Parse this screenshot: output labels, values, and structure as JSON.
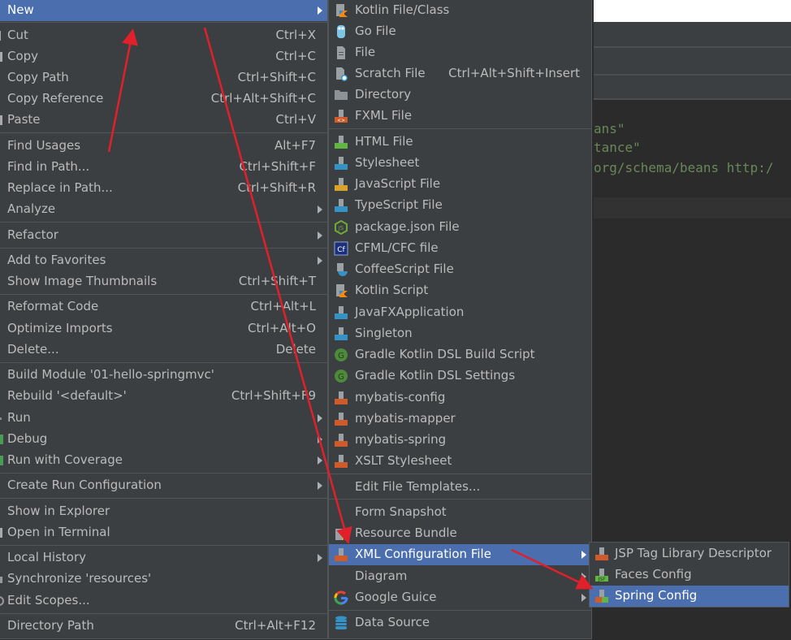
{
  "editor": {
    "code_lines": [
      "ans\"",
      "tance\"",
      "org/schema/beans http:/"
    ]
  },
  "context_menu": {
    "items": [
      {
        "label": "New",
        "shortcut": "",
        "submenu": true,
        "selected": true
      },
      {
        "label": "Cut",
        "shortcut": "Ctrl+X",
        "icon": "cut-icon"
      },
      {
        "label": "Copy",
        "shortcut": "Ctrl+C",
        "icon": "copy-icon"
      },
      {
        "label": "Copy Path",
        "shortcut": "Ctrl+Shift+C"
      },
      {
        "label": "Copy Reference",
        "shortcut": "Ctrl+Alt+Shift+C"
      },
      {
        "label": "Paste",
        "shortcut": "Ctrl+V",
        "icon": "paste-icon"
      },
      {
        "label": "Find Usages",
        "shortcut": "Alt+F7"
      },
      {
        "label": "Find in Path...",
        "shortcut": "Ctrl+Shift+F"
      },
      {
        "label": "Replace in Path...",
        "shortcut": "Ctrl+Shift+R"
      },
      {
        "label": "Analyze",
        "submenu": true
      },
      {
        "label": "Refactor",
        "submenu": true
      },
      {
        "label": "Add to Favorites",
        "submenu": true
      },
      {
        "label": "Show Image Thumbnails",
        "shortcut": "Ctrl+Shift+T"
      },
      {
        "label": "Reformat Code",
        "shortcut": "Ctrl+Alt+L"
      },
      {
        "label": "Optimize Imports",
        "shortcut": "Ctrl+Alt+O"
      },
      {
        "label": "Delete...",
        "shortcut": "Delete"
      },
      {
        "label": "Build Module '01-hello-springmvc'",
        "shortcut": ""
      },
      {
        "label": "Rebuild '<default>'",
        "shortcut": "Ctrl+Shift+F9"
      },
      {
        "label": "Run",
        "submenu": true,
        "icon": "run-icon"
      },
      {
        "label": "Debug",
        "submenu": true,
        "icon": "debug-icon"
      },
      {
        "label": "Run with Coverage",
        "submenu": true,
        "icon": "coverage-icon"
      },
      {
        "label": "Create Run Configuration",
        "submenu": true
      },
      {
        "label": "Show in Explorer"
      },
      {
        "label": "Open in Terminal",
        "icon": "terminal-icon"
      },
      {
        "label": "Local History",
        "submenu": true
      },
      {
        "label": "Synchronize 'resources'",
        "icon": "sync-icon"
      },
      {
        "label": "Edit Scopes...",
        "icon": "scopes-icon"
      },
      {
        "label": "Directory Path",
        "shortcut": "Ctrl+Alt+F12"
      }
    ]
  },
  "new_submenu": {
    "items": [
      {
        "label": "Kotlin File/Class",
        "icon": "kotlin-file-icon"
      },
      {
        "label": "Go File",
        "icon": "go-gopher-icon"
      },
      {
        "label": "File",
        "icon": "file-icon"
      },
      {
        "label": "Scratch File",
        "shortcut": "Ctrl+Alt+Shift+Insert",
        "icon": "scratch-file-icon"
      },
      {
        "label": "Directory",
        "icon": "folder-icon"
      },
      {
        "label": "FXML File",
        "icon": "fxml-file-icon"
      },
      {
        "label": "HTML File",
        "icon": "html-file-icon"
      },
      {
        "label": "Stylesheet",
        "icon": "css-file-icon"
      },
      {
        "label": "JavaScript File",
        "icon": "js-file-icon"
      },
      {
        "label": "TypeScript File",
        "icon": "ts-file-icon"
      },
      {
        "label": "package.json File",
        "icon": "nodejs-icon"
      },
      {
        "label": "CFML/CFC file",
        "icon": "cfml-icon"
      },
      {
        "label": "CoffeeScript File",
        "icon": "coffeescript-icon"
      },
      {
        "label": "Kotlin Script",
        "icon": "kotlin-script-icon"
      },
      {
        "label": "JavaFXApplication",
        "icon": "java-file-icon"
      },
      {
        "label": "Singleton",
        "icon": "java-file-icon"
      },
      {
        "label": "Gradle Kotlin DSL Build Script",
        "icon": "gradle-icon"
      },
      {
        "label": "Gradle Kotlin DSL Settings",
        "icon": "gradle-icon"
      },
      {
        "label": "mybatis-config",
        "icon": "xml-file-icon"
      },
      {
        "label": "mybatis-mapper",
        "icon": "xml-file-icon"
      },
      {
        "label": "mybatis-spring",
        "icon": "xml-file-icon"
      },
      {
        "label": "XSLT Stylesheet",
        "icon": "xml-file-icon"
      },
      {
        "label": "Edit File Templates..."
      },
      {
        "label": "Form Snapshot"
      },
      {
        "label": "Resource Bundle",
        "icon": "resource-bundle-icon"
      },
      {
        "label": "XML Configuration File",
        "submenu": true,
        "selected": true,
        "icon": "xml-file-icon"
      },
      {
        "label": "Diagram",
        "submenu": true
      },
      {
        "label": "Google Guice",
        "submenu": true,
        "icon": "google-icon"
      },
      {
        "label": "Data Source",
        "icon": "database-icon"
      }
    ]
  },
  "xml_submenu": {
    "items": [
      {
        "label": "JSP Tag Library Descriptor",
        "icon": "xml-file-icon"
      },
      {
        "label": "Faces Config",
        "icon": "jsf-file-icon"
      },
      {
        "label": "Spring Config",
        "icon": "spring-config-icon",
        "selected": true
      }
    ]
  },
  "colors": {
    "menu_bg": "#3c3f41",
    "selection": "#4b6eaf",
    "text": "#bbbbbb",
    "annotation_arrow": "#e0202a",
    "code_string": "#6a8759"
  }
}
